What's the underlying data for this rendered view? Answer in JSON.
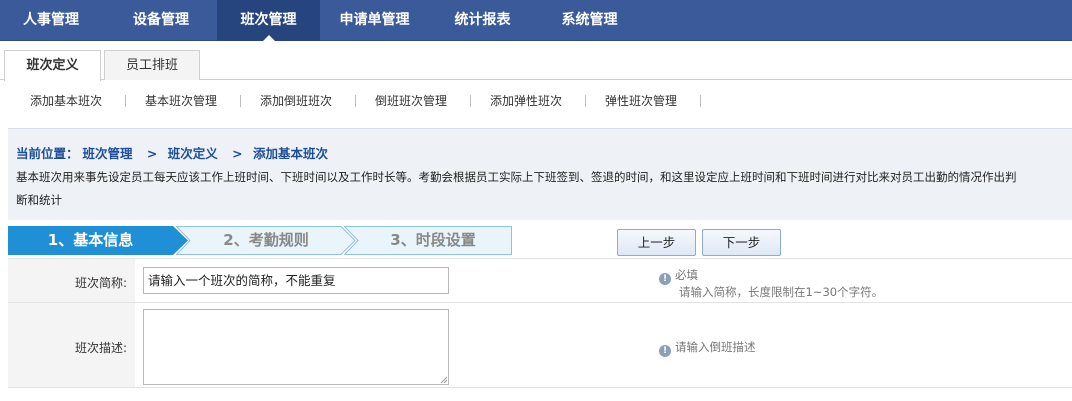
{
  "topnav": {
    "items": [
      {
        "label": "人事管理"
      },
      {
        "label": "设备管理"
      },
      {
        "label": "班次管理",
        "active": true
      },
      {
        "label": "申请单管理"
      },
      {
        "label": "统计报表"
      },
      {
        "label": "系统管理"
      }
    ]
  },
  "subtabs": [
    {
      "label": "班次定义",
      "active": true
    },
    {
      "label": "员工排班"
    }
  ],
  "funclinks": [
    "添加基本班次",
    "基本班次管理",
    "添加倒班班次",
    "倒班班次管理",
    "添加弹性班次",
    "弹性班次管理"
  ],
  "breadcrumb": {
    "prefix": "当前位置：",
    "items": [
      "班次管理",
      "班次定义",
      "添加基本班次"
    ],
    "separator": ">"
  },
  "description": "基本班次用来事先设定员工每天应该工作上班时间、下班时间以及工作时长等。考勤会根据员工实际上下班签到、签退的时间，和这里设定应上班时间和下班时间进行对比来对员工出勤的情况作出判断和统计",
  "steps": [
    {
      "label": "1、基本信息",
      "active": true
    },
    {
      "label": "2、考勤规则"
    },
    {
      "label": "3、时段设置"
    }
  ],
  "buttons": {
    "prev": "上一步",
    "next": "下一步"
  },
  "form": {
    "short_name": {
      "label": "班次简称:",
      "value": "请输入一个班次的简称，不能重复",
      "hint_title": "必填",
      "hint_text": "请输入简称，长度限制在1~30个字符。"
    },
    "description": {
      "label": "班次描述:",
      "value": "",
      "hint_text": "请输入倒班描述"
    }
  },
  "colors": {
    "nav_bg": "#3b5a9a",
    "nav_active": "#26447e",
    "breadcrumb": "#1c4e9b",
    "step_active": "#1f8fd6",
    "step_inactive": "#eaf4fb"
  }
}
